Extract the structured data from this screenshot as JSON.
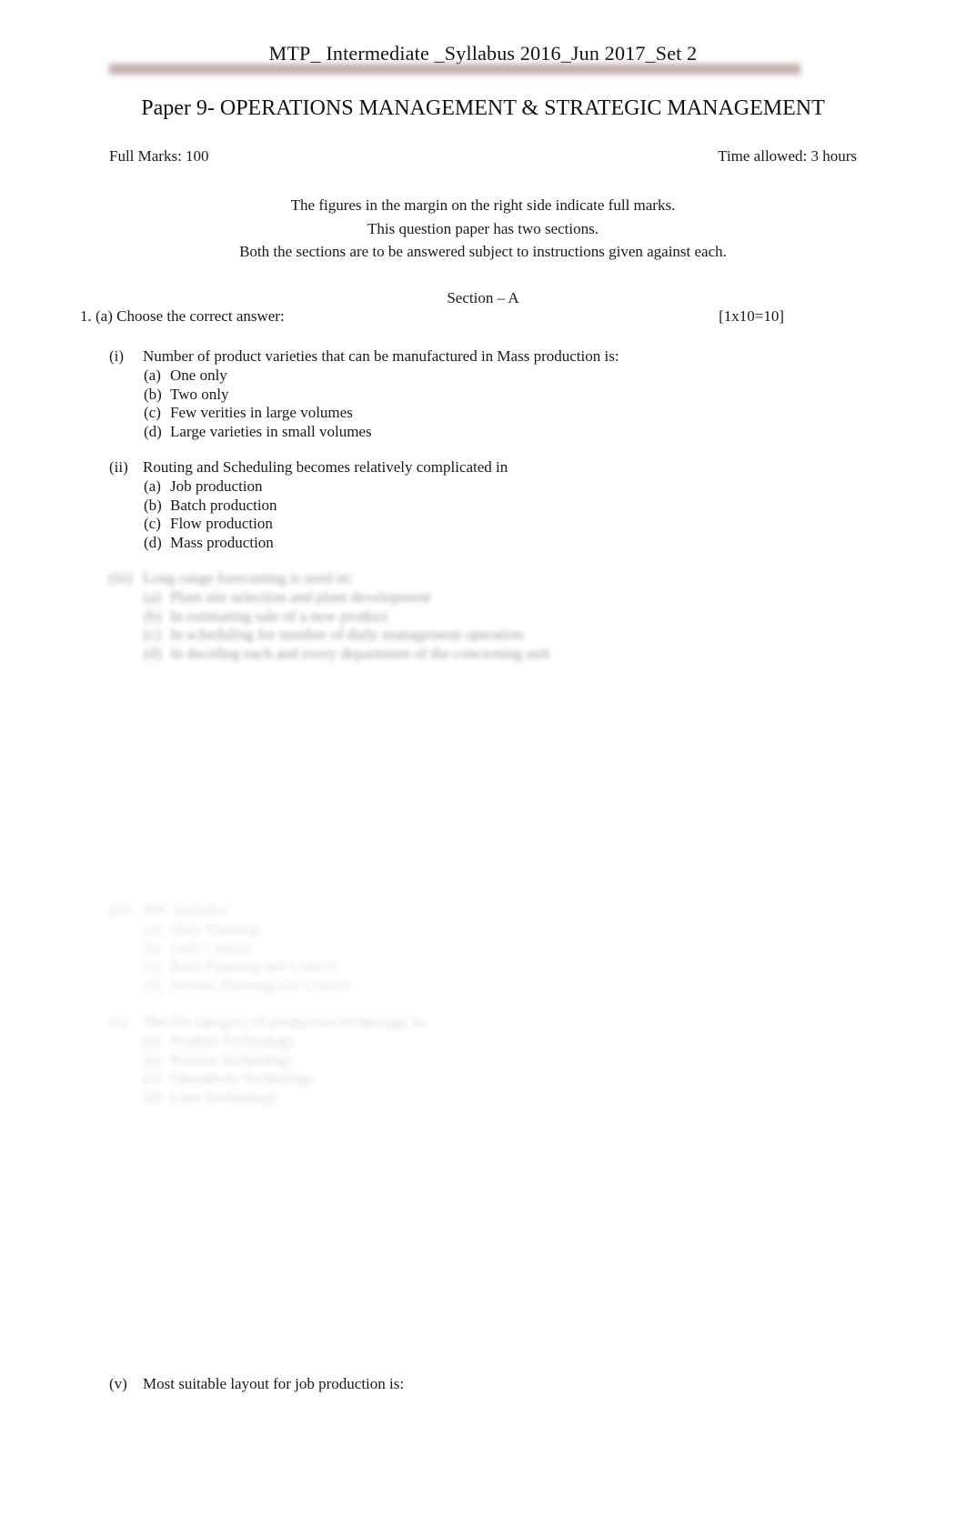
{
  "header": {
    "running_head": "MTP_ Intermediate _Syllabus 2016_Jun 2017_Set 2",
    "paper_title": "Paper 9- OPERATIONS MANAGEMENT & STRATEGIC MANAGEMENT",
    "rule_color": "#c3a9a9"
  },
  "marks": {
    "full_marks": "Full Marks: 100",
    "time_allowed": "Time allowed: 3 hours"
  },
  "instructions": [
    "The figures in the margin on the right side indicate full marks.",
    "This question paper has two sections.",
    "Both the sections are to be answered subject to instructions given against each."
  ],
  "section": {
    "heading": "Section   –  A",
    "question_label": "1. (a) Choose the correct answer:",
    "question_marks": "[1x10=10]"
  },
  "questions": [
    {
      "num": "(i)",
      "stem": "Number of product varieties that can be manufactured in Mass production is:",
      "options": [
        {
          "letter": "(a)",
          "text": "One only"
        },
        {
          "letter": "(b)",
          "text": "Two only"
        },
        {
          "letter": "(c)",
          "text": "Few verities in large volumes"
        },
        {
          "letter": "(d)",
          "text": "Large varieties in small volumes"
        }
      ]
    },
    {
      "num": "(ii)",
      "stem": "Routing and Scheduling becomes relatively complicated in",
      "options": [
        {
          "letter": "(a)",
          "text": "Job production"
        },
        {
          "letter": "(b)",
          "text": "Batch production"
        },
        {
          "letter": "(c)",
          "text": "Flow production"
        },
        {
          "letter": "(d)",
          "text": "Mass production"
        }
      ]
    },
    {
      "num": "(iii)",
      "stem": "Long range forecasting is used in:",
      "options": [
        {
          "letter": "(a)",
          "text": "Plant site selection and plant development"
        },
        {
          "letter": "(b)",
          "text": "In estimating sale of a new product"
        },
        {
          "letter": "(c)",
          "text": "In scheduling for number of daily management operation"
        },
        {
          "letter": "(d)",
          "text": "In deciding each and every department of the concerning unit"
        }
      ]
    },
    {
      "num": "(iv)",
      "stem": "PPC includes:",
      "options": [
        {
          "letter": "(a)",
          "text": "Only Planning"
        },
        {
          "letter": "(b)",
          "text": "Only Control"
        },
        {
          "letter": "(c)",
          "text": "Both Planning and Control"
        },
        {
          "letter": "(d)",
          "text": "Neither Planning nor Control"
        }
      ]
    },
    {
      "num": "(v)",
      "stem": "The life category of production technology is:",
      "options": [
        {
          "letter": "(a)",
          "text": "Product Technology"
        },
        {
          "letter": "(b)",
          "text": "Process Technology"
        },
        {
          "letter": "(c)",
          "text": "Operations Technology"
        },
        {
          "letter": "(d)",
          "text": "Lean Technology"
        }
      ]
    },
    {
      "num": "(v)",
      "stem": "Most suitable layout for job production is:",
      "options": []
    }
  ]
}
